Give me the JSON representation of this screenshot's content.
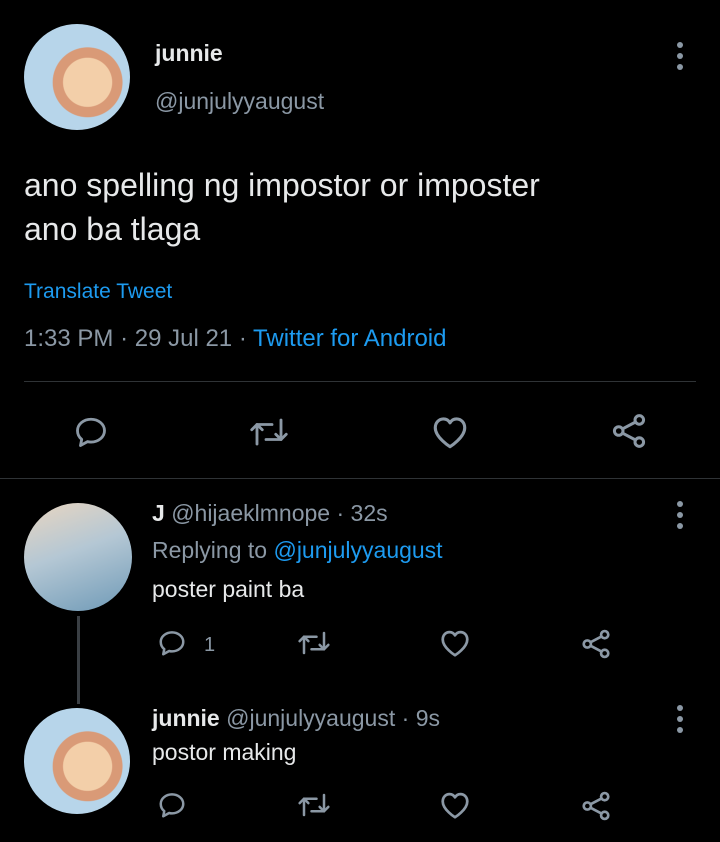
{
  "tweet": {
    "author_name": "junnie",
    "author_handle": "@junjulyyaugust",
    "text_line1": "ano spelling ng impostor or imposter",
    "text_line2": "ano ba tlaga",
    "translate_label": "Translate Tweet",
    "time": "1:33 PM",
    "date": "29 Jul 21",
    "source": "Twitter for Android",
    "separator": "·"
  },
  "replies": [
    {
      "author_name": "J",
      "author_handle": "@hijaeklmnope",
      "age": "32s",
      "replying_to_label": "Replying to",
      "replying_to_handle": "@junjulyyaugust",
      "text": "poster paint ba",
      "reply_count": "1"
    },
    {
      "author_name": "junnie",
      "author_handle": "@junjulyyaugust",
      "age": "9s",
      "text": "postor making"
    }
  ],
  "icons": {
    "reply": "speech-bubble-icon",
    "retweet": "retweet-icon",
    "like": "heart-icon",
    "share": "share-icon",
    "more": "kebab-menu-icon"
  },
  "colors": {
    "background": "#000000",
    "text": "#e7e9ea",
    "muted": "#8b98a5",
    "link": "#1d9bf0",
    "divider": "#2f3336"
  }
}
